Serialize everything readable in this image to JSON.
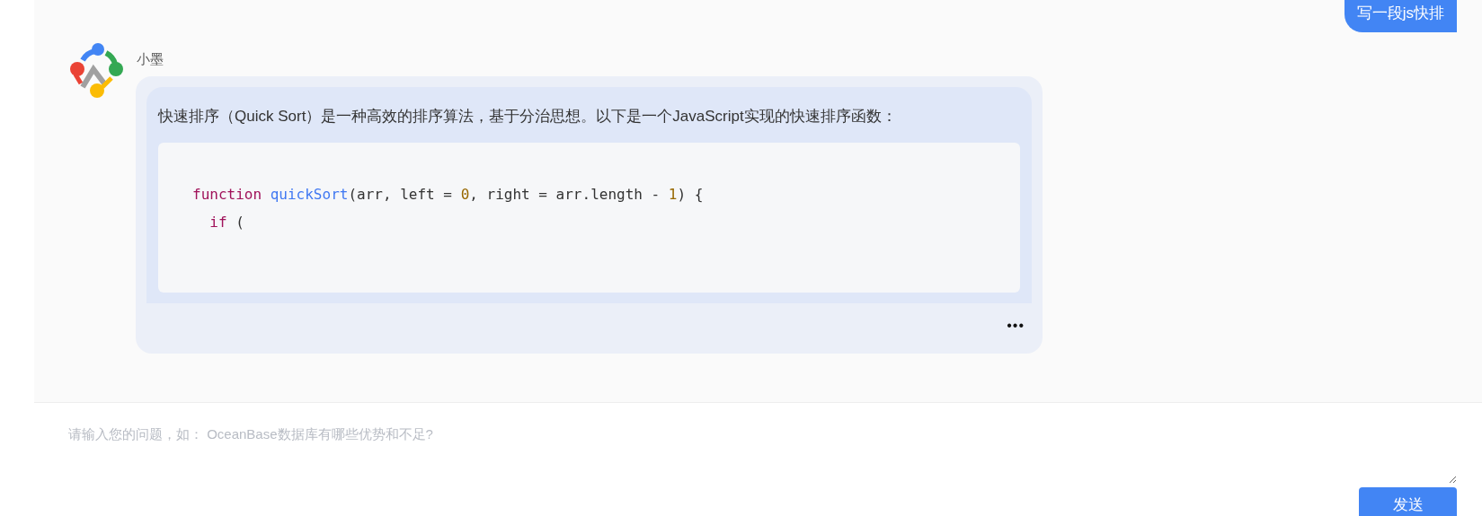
{
  "user_message": {
    "text": "写一段js快排"
  },
  "assistant": {
    "name": "小墨",
    "intro": "快速排序（Quick Sort）是一种高效的排序算法，基于分治思想。以下是一个JavaScript实现的快速排序函数：",
    "code_lines": [
      {
        "tokens": [
          {
            "kind": "keyword",
            "text": "function"
          },
          {
            "kind": "function",
            "text": " quickSort"
          },
          {
            "kind": "plain",
            "text": "(arr, left = "
          },
          {
            "kind": "number",
            "text": "0"
          },
          {
            "kind": "plain",
            "text": ", right = arr.length - "
          },
          {
            "kind": "number",
            "text": "1"
          },
          {
            "kind": "plain",
            "text": ") {"
          }
        ],
        "children": [
          {
            "tokens": [
              {
                "kind": "keyword",
                "text": "if"
              },
              {
                "kind": "plain",
                "text": " ("
              }
            ]
          }
        ]
      }
    ],
    "more_label": "•••"
  },
  "composer": {
    "placeholder": "请输入您的问题，如： OceanBase数据库有哪些优势和不足?",
    "send_label": "发送"
  }
}
